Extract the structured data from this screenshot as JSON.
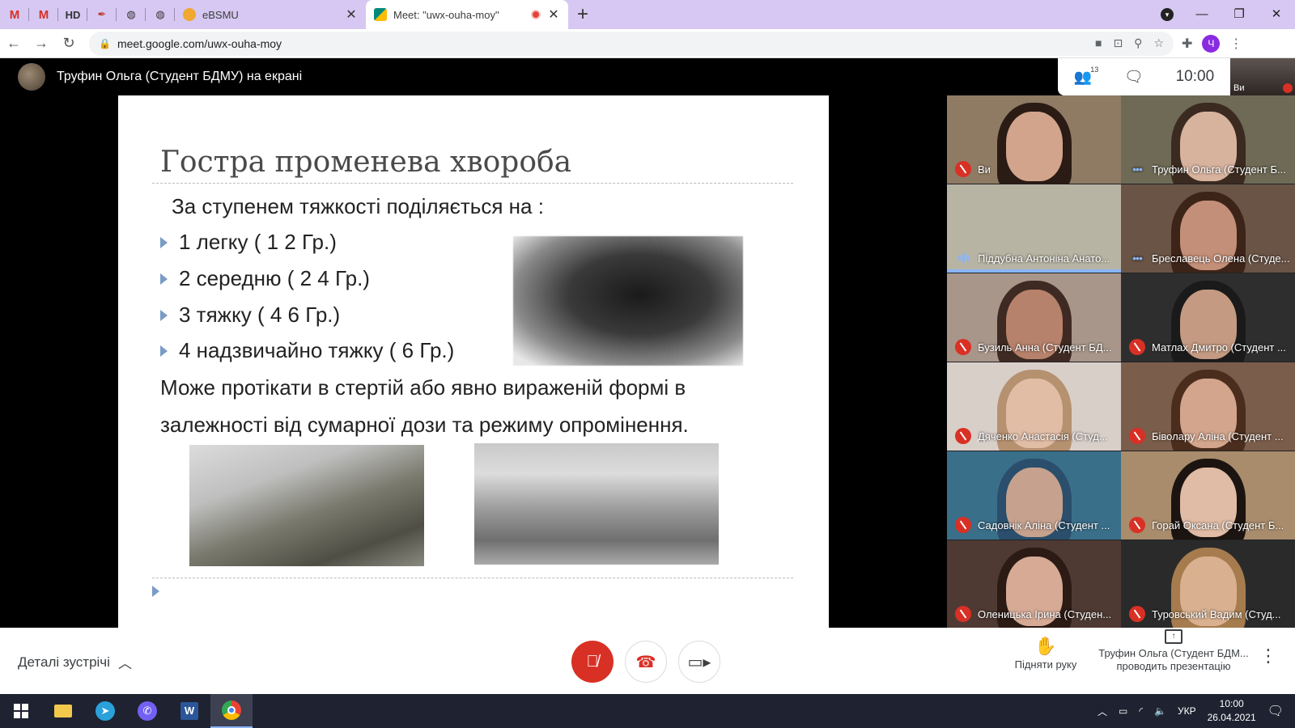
{
  "browser": {
    "pinned_tabs": [
      {
        "name": "gmail-1",
        "glyph": "M"
      },
      {
        "name": "gmail-2",
        "glyph": "M"
      },
      {
        "name": "hd",
        "glyph": "HD"
      },
      {
        "name": "pen",
        "glyph": "✒"
      },
      {
        "name": "globe-1",
        "glyph": "◍"
      },
      {
        "name": "globe-2",
        "glyph": "◍"
      }
    ],
    "tabs": [
      {
        "title": "eBSMU",
        "active": false,
        "favicon_color": "#f0a830"
      },
      {
        "title": "Meet: \"uwx-ouha-moy\"",
        "active": true,
        "favicon_color": "#00897b",
        "recording": true
      }
    ],
    "new_tab_glyph": "+",
    "url": "meet.google.com/uwx-ouha-moy",
    "profile_initial": "Ч"
  },
  "meet": {
    "presenter_label": "Труфин Ольга (Студент БДМУ) на екрані",
    "participant_count": "13",
    "time": "10:00",
    "self_label": "Ви",
    "slide": {
      "title": "Гостра променева хвороба",
      "subtitle": "За ступенем тяжкості поділяється на :",
      "bullets": [
        "1 легку ( 1 2 Гр.)",
        "2 середню ( 2 4 Гр.)",
        "3 тяжку ( 4 6 Гр.)",
        "4 надзвичайно тяжку ( 6 Гр.)"
      ],
      "paragraph": "Може протікати в стертій або явно вираженій формі в залежності від сумарної дози та режиму опромінення."
    },
    "participants": [
      {
        "name": "Ви",
        "status": "muted",
        "bg": "#8f7b64",
        "hair": "#2a1b14",
        "skin": "#d2a48c"
      },
      {
        "name": "Труфин Ольга (Студент Б...",
        "status": "dots",
        "bg": "#6e6a56",
        "hair": "#3b2a20",
        "skin": "#d7b39e"
      },
      {
        "name": "Піддубна Антоніна Анато...",
        "status": "speaking",
        "bg": "#b8b4a4",
        "hair": "#b8b4a4",
        "skin": "#b8b4a4"
      },
      {
        "name": "Бреславець Олена (Студе...",
        "status": "dots",
        "bg": "#6a5446",
        "hair": "#3d2418",
        "skin": "#c48f78"
      },
      {
        "name": "Бузиль Анна (Студент БД...",
        "status": "muted",
        "bg": "#a8968a",
        "hair": "#3e2a22",
        "skin": "#b7826b"
      },
      {
        "name": "Матлах Дмитро (Студент ...",
        "status": "muted",
        "bg": "#2e2e2e",
        "hair": "#1a1a1a",
        "skin": "#c49a82"
      },
      {
        "name": "Дяченко Анастасія (Студ...",
        "status": "muted",
        "bg": "#d9cfc9",
        "hair": "#b59170",
        "skin": "#e2bda6"
      },
      {
        "name": "Біволару Аліна (Студент ...",
        "status": "muted",
        "bg": "#7a5d4a",
        "hair": "#4a2d1d",
        "skin": "#d3a58c"
      },
      {
        "name": "Садовнік Аліна (Студент ...",
        "status": "muted",
        "bg": "#3a6f8a",
        "hair": "#2a4e6b",
        "skin": "#c6a28e"
      },
      {
        "name": "Горай Оксана (Студент Б...",
        "status": "muted",
        "bg": "#a88c6c",
        "hair": "#1c1410",
        "skin": "#e0bba5"
      },
      {
        "name": "Оленицька Ірина (Студен...",
        "status": "muted",
        "bg": "#4e3a33",
        "hair": "#2c1a14",
        "skin": "#d6aa95"
      },
      {
        "name": "Туровський Вадим (Студ...",
        "status": "muted",
        "bg": "#2a2a2a",
        "hair": "#a67c4e",
        "skin": "#d9b190"
      }
    ]
  },
  "controls": {
    "details_label": "Деталі зустрічі",
    "raise_hand_label": "Підняти руку",
    "presenting_line1": "Труфин Ольга (Студент БДМ...",
    "presenting_line2": "проводить презентацію"
  },
  "taskbar": {
    "lang": "УКР",
    "time": "10:00",
    "date": "26.04.2021"
  }
}
